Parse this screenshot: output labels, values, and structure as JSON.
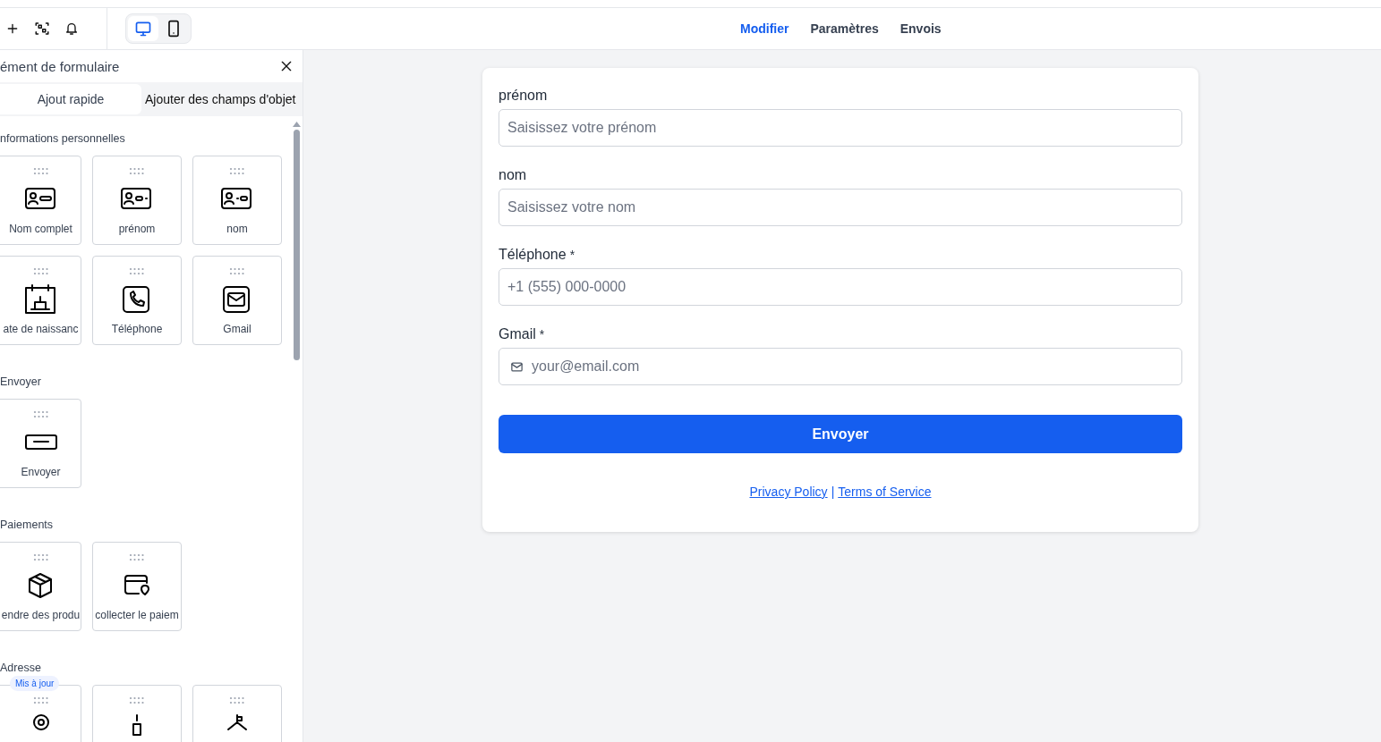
{
  "toolbar": {
    "devices": [
      {
        "kind": "desktop",
        "selected": true
      },
      {
        "kind": "mobile",
        "selected": false
      }
    ]
  },
  "nav_tabs": [
    {
      "label": "Modifier",
      "selected": true
    },
    {
      "label": "Paramètres",
      "selected": false
    },
    {
      "label": "Envois",
      "selected": false
    }
  ],
  "panel": {
    "title": "ément de formulaire",
    "tabs": [
      {
        "label": "Ajout rapide",
        "selected": true
      },
      {
        "label": "Ajouter des champs d'objet",
        "selected": false
      }
    ],
    "sections": [
      {
        "title": "nformations personnelles",
        "items": [
          {
            "kind": "fullname",
            "label": "Nom complet"
          },
          {
            "kind": "firstname",
            "label": "prénom"
          },
          {
            "kind": "lastname",
            "label": "nom"
          },
          {
            "kind": "birthday",
            "label": "ate de naissanc"
          },
          {
            "kind": "phone",
            "label": "Téléphone"
          },
          {
            "kind": "email",
            "label": "Gmail"
          }
        ]
      },
      {
        "title": "Envoyer",
        "items": [
          {
            "kind": "submit",
            "label": "Envoyer"
          }
        ]
      },
      {
        "title": "Paiements",
        "items": [
          {
            "kind": "products",
            "label": "endre des produ"
          },
          {
            "kind": "payment",
            "label": "collecter le paiem"
          }
        ]
      },
      {
        "title": "Adresse",
        "items": [
          {
            "kind": "address",
            "badge": "Mis à jour"
          },
          {
            "kind": "postal"
          },
          {
            "kind": "route"
          }
        ]
      }
    ]
  },
  "form": {
    "fields": [
      {
        "label": "prénom",
        "placeholder": "Saisissez votre prénom",
        "kind": "text"
      },
      {
        "label": "nom",
        "placeholder": "Saisissez votre nom",
        "kind": "text"
      },
      {
        "label": "Téléphone",
        "required_mark": "*",
        "placeholder": "+1 (555) 000-0000",
        "kind": "text"
      },
      {
        "label": "Gmail",
        "required_mark": "*",
        "placeholder": "your@email.com",
        "kind": "email"
      }
    ],
    "submit": "Envoyer",
    "links": [
      "Privacy Policy",
      "Terms of Service"
    ],
    "separator": "|"
  }
}
